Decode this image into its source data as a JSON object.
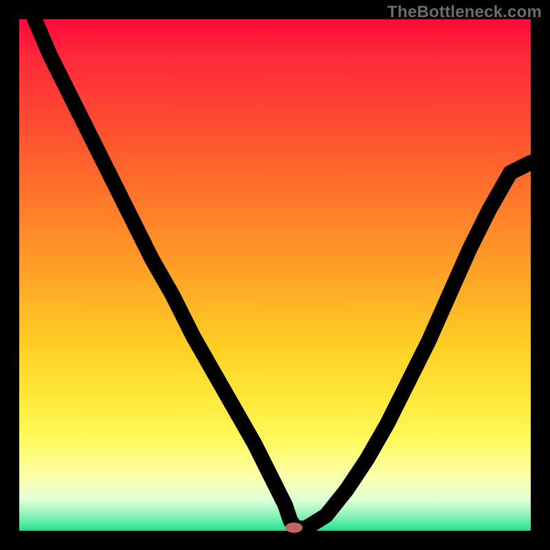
{
  "watermark": "TheBottleneck.com",
  "colors": {
    "frame_bg": "#000000",
    "gradient_top": "#ff0a3a",
    "gradient_bottom": "#1fe28e",
    "curve": "#000000",
    "marker": "#c0655f"
  },
  "chart_data": {
    "type": "line",
    "title": "",
    "xlabel": "",
    "ylabel": "",
    "xlim": [
      0,
      100
    ],
    "ylim": [
      0,
      100
    ],
    "grid": false,
    "legend": null,
    "series": [
      {
        "name": "bottleneck-curve",
        "x": [
          3,
          6,
          10,
          14,
          18,
          22,
          26,
          30,
          34,
          38,
          42,
          46,
          48,
          50,
          52,
          53,
          54,
          56,
          60,
          64,
          68,
          72,
          76,
          80,
          84,
          88,
          92,
          96,
          100
        ],
        "y": [
          100,
          93,
          85,
          77,
          69,
          61,
          53,
          46,
          38,
          31,
          24,
          17,
          13,
          9,
          5,
          2,
          0.5,
          0.5,
          3,
          8,
          14,
          21,
          29,
          37,
          46,
          55,
          63,
          70,
          72
        ]
      }
    ],
    "marker": {
      "x": 53.7,
      "y": 0.6,
      "rx": 1.7,
      "ry": 1.0
    }
  }
}
